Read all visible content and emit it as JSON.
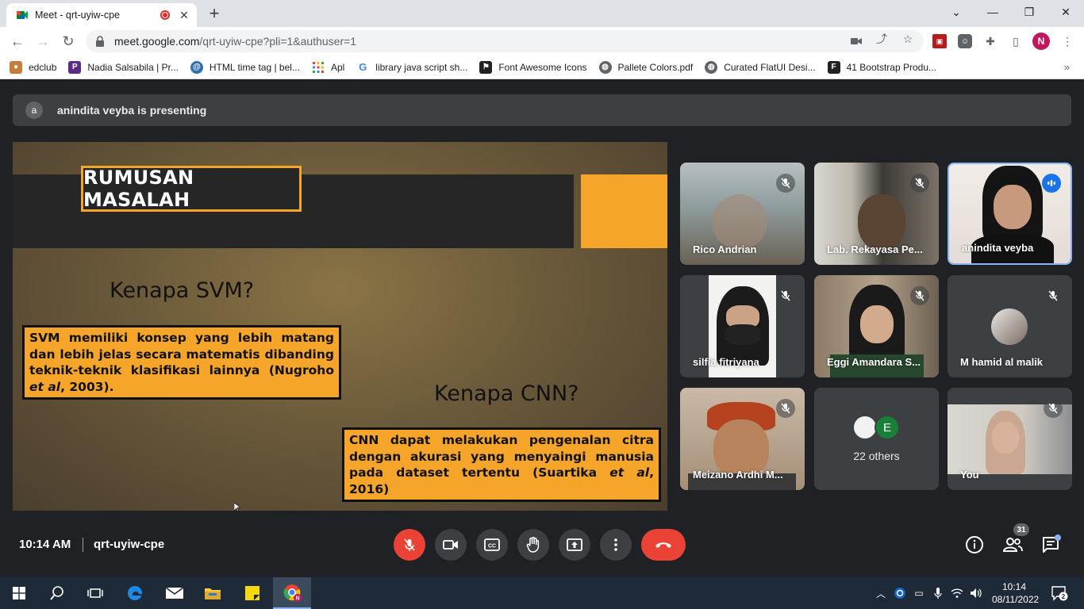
{
  "browser": {
    "tab_title": "Meet - qrt-uyiw-cpe",
    "url_host": "meet.google.com",
    "url_path": "/qrt-uyiw-cpe?pli=1&authuser=1",
    "profile_initial": "N",
    "bookmarks": [
      {
        "label": "edclub",
        "icon": "cookie-icon",
        "color": "#c77d3a"
      },
      {
        "label": "Nadia Salsabila | Pr...",
        "icon": "p-logo-icon",
        "color": "#5b2a86"
      },
      {
        "label": "HTML time tag | bel...",
        "icon": "swirl-icon",
        "color": "#2f6fb5"
      },
      {
        "label": "Apl",
        "icon": "apps-grid-icon",
        "color": "#ea4335"
      },
      {
        "label": "library java script sh...",
        "icon": "google-icon",
        "color": "#4285f4"
      },
      {
        "label": "Font Awesome Icons",
        "icon": "flag-icon",
        "color": "#222222"
      },
      {
        "label": "Pallete Colors.pdf",
        "icon": "globe-icon",
        "color": "#5f6368"
      },
      {
        "label": "Curated FlatUI Desi...",
        "icon": "globe-icon",
        "color": "#5f6368"
      },
      {
        "label": "41 Bootstrap Produ...",
        "icon": "f-logo-icon",
        "color": "#222222"
      }
    ]
  },
  "meet": {
    "presenter_initial": "a",
    "presenting_text": "anindita veyba is presenting",
    "slide": {
      "title": "RUMUSAN MASALAH",
      "heading_svm": "Kenapa SVM?",
      "heading_cnn": "Kenapa CNN?",
      "svm_text_before": "SVM memiliki konsep yang lebih matang dan lebih jelas secara matematis dibanding teknik-teknik klasifikasi lainnya (Nugroho ",
      "svm_text_italic": "et al",
      "svm_text_after": ", 2003).",
      "cnn_text_before": "CNN dapat melakukan pengenalan citra dengan akurasi yang menyaingi manusia pada dataset tertentu (Suartika ",
      "cnn_text_italic": "et al",
      "cnn_text_after": ", 2016)"
    },
    "participants": [
      {
        "name": "Rico Andrian",
        "state": "muted"
      },
      {
        "name": "Lab. Rekayasa Pe...",
        "state": "muted"
      },
      {
        "name": "anindita veyba",
        "state": "speaking"
      },
      {
        "name": "silfia fitriyana",
        "state": "muted"
      },
      {
        "name": "Eggi Amandara S...",
        "state": "muted"
      },
      {
        "name": "M hamid al malik",
        "state": "muted"
      },
      {
        "name": "Meizano Ardhi M...",
        "state": "muted"
      },
      {
        "name": "22 others",
        "state": "group",
        "avatar_letter": "E"
      },
      {
        "name": "You",
        "state": "muted"
      }
    ],
    "time": "10:14 AM",
    "meeting_code": "qrt-uyiw-cpe",
    "people_count": "31"
  },
  "taskbar": {
    "time": "10:14",
    "date": "08/11/2022",
    "notification_count": "2"
  }
}
